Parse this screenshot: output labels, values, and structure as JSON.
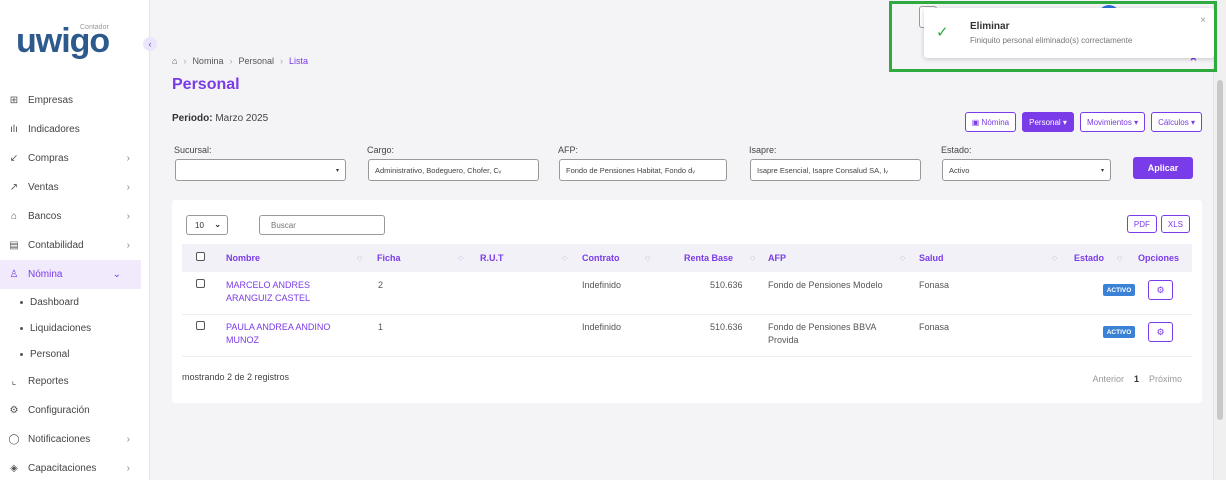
{
  "logo": {
    "text": "uwigo",
    "sub": "Contador"
  },
  "sidebar": {
    "collapse": "‹",
    "items": [
      {
        "label": "Empresas",
        "icon": "building-icon",
        "glyph": "⊞",
        "chev": ""
      },
      {
        "label": "Indicadores",
        "icon": "bar-chart-icon",
        "glyph": "ılı",
        "chev": ""
      },
      {
        "label": "Compras",
        "icon": "arrow-down-left-icon",
        "glyph": "↙",
        "chev": "›"
      },
      {
        "label": "Ventas",
        "icon": "arrow-up-right-icon",
        "glyph": "↗",
        "chev": "›"
      },
      {
        "label": "Bancos",
        "icon": "bank-icon",
        "glyph": "⌂",
        "chev": "›"
      },
      {
        "label": "Contabilidad",
        "icon": "calculator-icon",
        "glyph": "▤",
        "chev": "›"
      },
      {
        "label": "Nómina",
        "icon": "users-icon",
        "glyph": "♙",
        "chev": "⌄"
      }
    ],
    "subitems": [
      "Dashboard",
      "Liquidaciones",
      "Personal"
    ],
    "items_bottom": [
      {
        "label": "Reportes",
        "icon": "line-chart-icon",
        "glyph": "⌞",
        "chev": ""
      },
      {
        "label": "Configuración",
        "icon": "gear-icon",
        "glyph": "⚙",
        "chev": ""
      },
      {
        "label": "Notificaciones",
        "icon": "bell-icon",
        "glyph": "◯",
        "chev": "›"
      },
      {
        "label": "Capacitaciones",
        "icon": "graduation-cap-icon",
        "glyph": "◈",
        "chev": "›"
      }
    ]
  },
  "breadcrumb": {
    "home": "⌂",
    "items": [
      "Nomina",
      "Personal"
    ],
    "current": "Lista",
    "sep": "›"
  },
  "page_title": "Personal",
  "periodo": {
    "label": "Periodo:",
    "value": "Marzo 2025"
  },
  "actions": {
    "nomina": "▣ Nómina",
    "personal": "Personal ▾",
    "movimientos": "Movimientos ▾",
    "calculos": "Cálculos ▾"
  },
  "filters": {
    "sucursal": {
      "label": "Sucursal:",
      "value": ""
    },
    "cargo": {
      "label": "Cargo:",
      "value": "Administrativo, Bodeguero, Chofer, Cᵥ"
    },
    "afp": {
      "label": "AFP:",
      "value": "Fondo de Pensiones Habitat, Fondo dᵥ"
    },
    "isapre": {
      "label": "Isapre:",
      "value": "Isapre Esencial, Isapre Consalud SA, Iᵥ"
    },
    "estado": {
      "label": "Estado:",
      "value": "Activo"
    },
    "apply": "Aplicar",
    "caret": "▾"
  },
  "table_controls": {
    "page_size": "10",
    "caret": "⌄",
    "search_placeholder": "Buscar",
    "pdf": "PDF",
    "xls": "XLS"
  },
  "table": {
    "headers": {
      "nombre": "Nombre",
      "ficha": "Ficha",
      "rut": "R.U.T",
      "contrato": "Contrato",
      "renta": "Renta Base",
      "afp": "AFP",
      "salud": "Salud",
      "estado": "Estado",
      "opciones": "Opciones"
    },
    "sort_glyph": "◇",
    "rows": [
      {
        "nombre1": "MARCELO ANDRES",
        "nombre2": "ARANGUIZ CASTEL",
        "ficha": "2",
        "rut": "",
        "contrato": "Indefinido",
        "renta": "510.636",
        "afp1": "Fondo de Pensiones Modelo",
        "afp2": "",
        "salud": "Fonasa",
        "estado": "ACTIVO",
        "opt": "⚙"
      },
      {
        "nombre1": "PAULA ANDREA ANDINO",
        "nombre2": "MUNOZ",
        "ficha": "1",
        "rut": "",
        "contrato": "Indefinido",
        "renta": "510.636",
        "afp1": "Fondo de Pensiones BBVA",
        "afp2": "Provida",
        "salud": "Fonasa",
        "estado": "ACTIVO",
        "opt": "⚙"
      }
    ]
  },
  "footer": {
    "showing": "mostrando 2 de 2 registros",
    "prev": "Anterior",
    "page": "1",
    "next": "Próximo"
  },
  "toast": {
    "title": "Eliminar",
    "message": "Finiquito personal eliminado(s) correctamente",
    "check": "✓",
    "close": "×"
  },
  "star": "★",
  "colors": {
    "accent": "#7a3be8",
    "success": "#2eaa3e",
    "badge": "#3b82d6"
  }
}
